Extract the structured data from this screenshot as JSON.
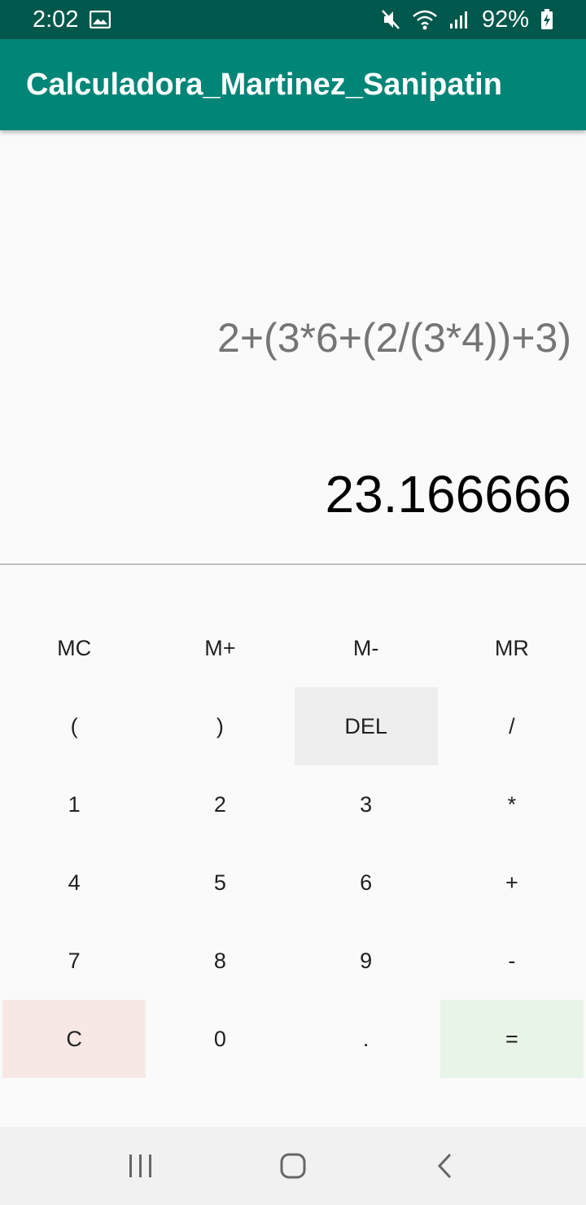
{
  "status_bar": {
    "time": "2:02",
    "battery": "92%",
    "icons": [
      "image-icon",
      "mute-icon",
      "wifi-icon",
      "signal-icon",
      "battery-charging-icon"
    ]
  },
  "app_bar": {
    "title": "Calculadora_Martinez_Sanipatin"
  },
  "display": {
    "expression": "2+(3*6+(2/(3*4))+3)",
    "result": "23.166666"
  },
  "keypad": {
    "memory": [
      "MC",
      "M+",
      "M-",
      "MR"
    ],
    "rows": [
      [
        "(",
        ")",
        "DEL",
        "/"
      ],
      [
        "1",
        "2",
        "3",
        "*"
      ],
      [
        "4",
        "5",
        "6",
        "+"
      ],
      [
        "7",
        "8",
        "9",
        "-"
      ],
      [
        "C",
        "0",
        ".",
        "="
      ]
    ]
  },
  "nav_bar": {
    "icons": [
      "recent-apps-icon",
      "home-icon",
      "back-icon"
    ]
  },
  "colors": {
    "status_bar": "#00574b",
    "app_bar": "#008577",
    "clear_key": "#f7e8e6",
    "equals_key": "#e7f4e7",
    "del_key": "#eeeeee"
  }
}
